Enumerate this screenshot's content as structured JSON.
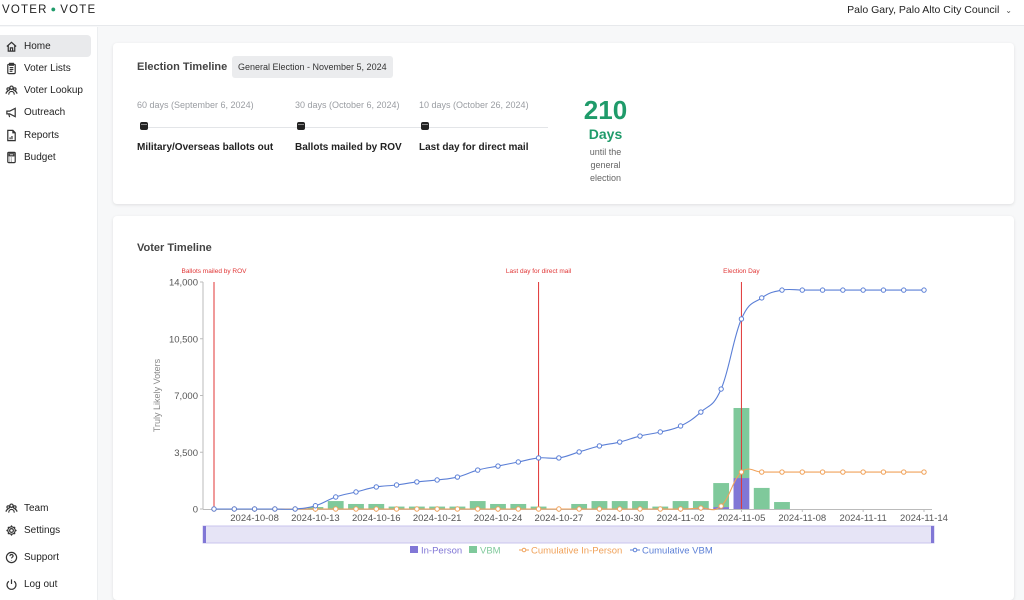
{
  "app": {
    "logo_left": "VOTER",
    "logo_right": "VOTE",
    "user_label": "Palo Gary, Palo Alto City Council"
  },
  "sidebar": {
    "items": [
      {
        "label": "Home",
        "icon": "home-icon",
        "active": true
      },
      {
        "label": "Voter Lists",
        "icon": "clipboard-icon"
      },
      {
        "label": "Voter Lookup",
        "icon": "users-icon"
      },
      {
        "label": "Outreach",
        "icon": "megaphone-icon"
      },
      {
        "label": "Reports",
        "icon": "report-icon"
      },
      {
        "label": "Budget",
        "icon": "calculator-icon"
      }
    ],
    "bottom_items": [
      {
        "label": "Team",
        "icon": "team-icon"
      },
      {
        "label": "Settings",
        "icon": "gear-icon"
      },
      {
        "label": "Support",
        "icon": "help-icon"
      },
      {
        "label": "Log out",
        "icon": "power-icon"
      }
    ]
  },
  "election_timeline": {
    "title": "Election Timeline",
    "election_select": "General Election - November 5, 2024",
    "milestones": [
      {
        "date": "60 days (September 6, 2024)",
        "label": "Military/Overseas ballots out"
      },
      {
        "date": "30 days (October 6, 2024)",
        "label": "Ballots mailed by ROV"
      },
      {
        "date": "10 days (October 26, 2024)",
        "label": "Last day for direct mail"
      }
    ],
    "countdown": {
      "value": "210",
      "unit": "Days",
      "note_lines": [
        "until the",
        "general",
        "election"
      ]
    }
  },
  "voter_timeline": {
    "title": "Voter Timeline"
  },
  "colors": {
    "accent": "#1f9b6a",
    "in_person": "#8177d6",
    "vbm": "#7fc99b",
    "cumulative_in_person": "#f0a25a",
    "cumulative_vbm": "#5b7fd6",
    "marker": "#e03535"
  },
  "chart_data": {
    "type": "bar",
    "title": "Voter Timeline",
    "xlabel": "",
    "ylabel": "Truly Likely Voters",
    "ylim": [
      0,
      14000
    ],
    "yticks": [
      0,
      3500,
      7000,
      10500,
      14000
    ],
    "ytick_labels": [
      "0",
      "3,500",
      "7,000",
      "10,500",
      "14,000"
    ],
    "grid": false,
    "legend_position": "bottom-center",
    "categories": [
      "2024-10-06",
      "2024-10-07",
      "2024-10-08",
      "2024-10-09",
      "2024-10-10",
      "2024-10-13",
      "2024-10-14",
      "2024-10-15",
      "2024-10-16",
      "2024-10-17",
      "2024-10-18",
      "2024-10-21",
      "2024-10-22",
      "2024-10-23",
      "2024-10-24",
      "2024-10-25",
      "2024-10-26",
      "2024-10-27",
      "2024-10-28",
      "2024-10-29",
      "2024-10-30",
      "2024-10-31",
      "2024-11-01",
      "2024-11-02",
      "2024-11-03",
      "2024-11-04",
      "2024-11-05",
      "2024-11-06",
      "2024-11-07",
      "2024-11-08",
      "2024-11-09",
      "2024-11-10",
      "2024-11-11",
      "2024-11-12",
      "2024-11-13",
      "2024-11-14"
    ],
    "tick_label_every": 3,
    "tick_label_offset": 2,
    "series": [
      {
        "name": "In-Person",
        "type": "bar",
        "stack": "total",
        "values": [
          0,
          0,
          0,
          0,
          0,
          0,
          0,
          0,
          0,
          0,
          0,
          0,
          0,
          0,
          0,
          0,
          0,
          0,
          0,
          0,
          0,
          0,
          0,
          0,
          60,
          120,
          1910,
          0,
          0,
          0,
          0,
          0,
          0,
          0,
          0,
          0
        ]
      },
      {
        "name": "VBM",
        "type": "bar",
        "stack": "total",
        "values": [
          0,
          0,
          0,
          0,
          0,
          120,
          490,
          310,
          310,
          150,
          150,
          150,
          150,
          490,
          310,
          310,
          150,
          0,
          310,
          490,
          490,
          490,
          150,
          490,
          430,
          1480,
          4320,
          1300,
          430,
          0,
          0,
          0,
          0,
          0,
          0,
          0
        ]
      },
      {
        "name": "Cumulative In-Person",
        "type": "line",
        "values": [
          0,
          0,
          0,
          0,
          0,
          0,
          0,
          0,
          0,
          0,
          0,
          0,
          0,
          0,
          0,
          0,
          0,
          0,
          0,
          0,
          0,
          0,
          0,
          0,
          60,
          180,
          2280,
          2280,
          2280,
          2280,
          2280,
          2280,
          2280,
          2280,
          2280,
          2280
        ]
      },
      {
        "name": "Cumulative VBM",
        "type": "line",
        "values": [
          0,
          0,
          0,
          0,
          0,
          200,
          740,
          1050,
          1360,
          1480,
          1670,
          1790,
          1970,
          2400,
          2650,
          2900,
          3150,
          3150,
          3520,
          3890,
          4130,
          4500,
          4750,
          5120,
          5980,
          7400,
          11720,
          13020,
          13500,
          13500,
          13500,
          13500,
          13500,
          13500,
          13500,
          13500
        ]
      }
    ],
    "annotations": [
      {
        "label": "Ballots mailed by ROV",
        "category": "2024-10-06"
      },
      {
        "label": "Last day for direct mail",
        "category": "2024-10-26"
      },
      {
        "label": "Election Day",
        "category": "2024-11-05"
      }
    ],
    "zoom_slider_range": [
      0,
      1
    ]
  }
}
